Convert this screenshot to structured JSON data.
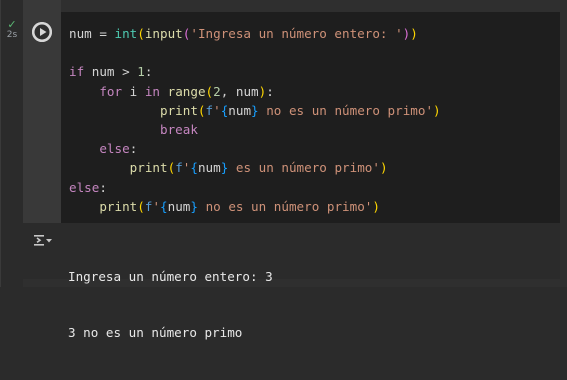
{
  "cell": {
    "exec_time": "2s"
  },
  "code_lines": [
    [
      [
        "plain",
        "num = "
      ],
      [
        "bi",
        "int"
      ],
      [
        "br1",
        "("
      ],
      [
        "fn",
        "input"
      ],
      [
        "br2",
        "("
      ],
      [
        "str",
        "'Ingresa un número entero: '"
      ],
      [
        "br2",
        ")"
      ],
      [
        "br1",
        ")"
      ]
    ],
    [],
    [
      [
        "kw",
        "if"
      ],
      [
        "plain",
        " num > "
      ],
      [
        "num",
        "1"
      ],
      [
        "plain",
        ":"
      ]
    ],
    [
      [
        "plain",
        "    "
      ],
      [
        "kw",
        "for"
      ],
      [
        "plain",
        " i "
      ],
      [
        "kw",
        "in"
      ],
      [
        "plain",
        " "
      ],
      [
        "fn",
        "range"
      ],
      [
        "br1",
        "("
      ],
      [
        "num",
        "2"
      ],
      [
        "plain",
        ", num"
      ],
      [
        "br1",
        ")"
      ],
      [
        "plain",
        ":"
      ]
    ],
    [
      [
        "plain",
        "            "
      ],
      [
        "fn",
        "print"
      ],
      [
        "br1",
        "("
      ],
      [
        "kwb",
        "f"
      ],
      [
        "str",
        "'"
      ],
      [
        "br3",
        "{"
      ],
      [
        "plain",
        "num"
      ],
      [
        "br3",
        "}"
      ],
      [
        "str",
        " no es un número primo'"
      ],
      [
        "br1",
        ")"
      ]
    ],
    [
      [
        "plain",
        "            "
      ],
      [
        "kw",
        "break"
      ]
    ],
    [
      [
        "plain",
        "    "
      ],
      [
        "kw",
        "else"
      ],
      [
        "plain",
        ":"
      ]
    ],
    [
      [
        "plain",
        "        "
      ],
      [
        "fn",
        "print"
      ],
      [
        "br1",
        "("
      ],
      [
        "kwb",
        "f"
      ],
      [
        "str",
        "'"
      ],
      [
        "br3",
        "{"
      ],
      [
        "plain",
        "num"
      ],
      [
        "br3",
        "}"
      ],
      [
        "str",
        " es un número primo'"
      ],
      [
        "br1",
        ")"
      ]
    ],
    [
      [
        "kw",
        "else"
      ],
      [
        "plain",
        ":"
      ]
    ],
    [
      [
        "plain",
        "    "
      ],
      [
        "fn",
        "print"
      ],
      [
        "br1",
        "("
      ],
      [
        "kwb",
        "f"
      ],
      [
        "str",
        "'"
      ],
      [
        "br3",
        "{"
      ],
      [
        "plain",
        "num"
      ],
      [
        "br3",
        "}"
      ],
      [
        "str",
        " no es un número primo'"
      ],
      [
        "br1",
        ")"
      ]
    ]
  ],
  "output": {
    "lines": [
      "Ingresa un número entero: 3",
      "3 no es un número primo"
    ]
  },
  "icons": {
    "run": "play-icon",
    "output_toggle": "output-menu-icon",
    "status": "check-icon"
  },
  "colors": {
    "keyword": "#c586c0",
    "function": "#dcdcaa",
    "string": "#ce9178",
    "number": "#b5cea8",
    "success": "#5bb974"
  }
}
